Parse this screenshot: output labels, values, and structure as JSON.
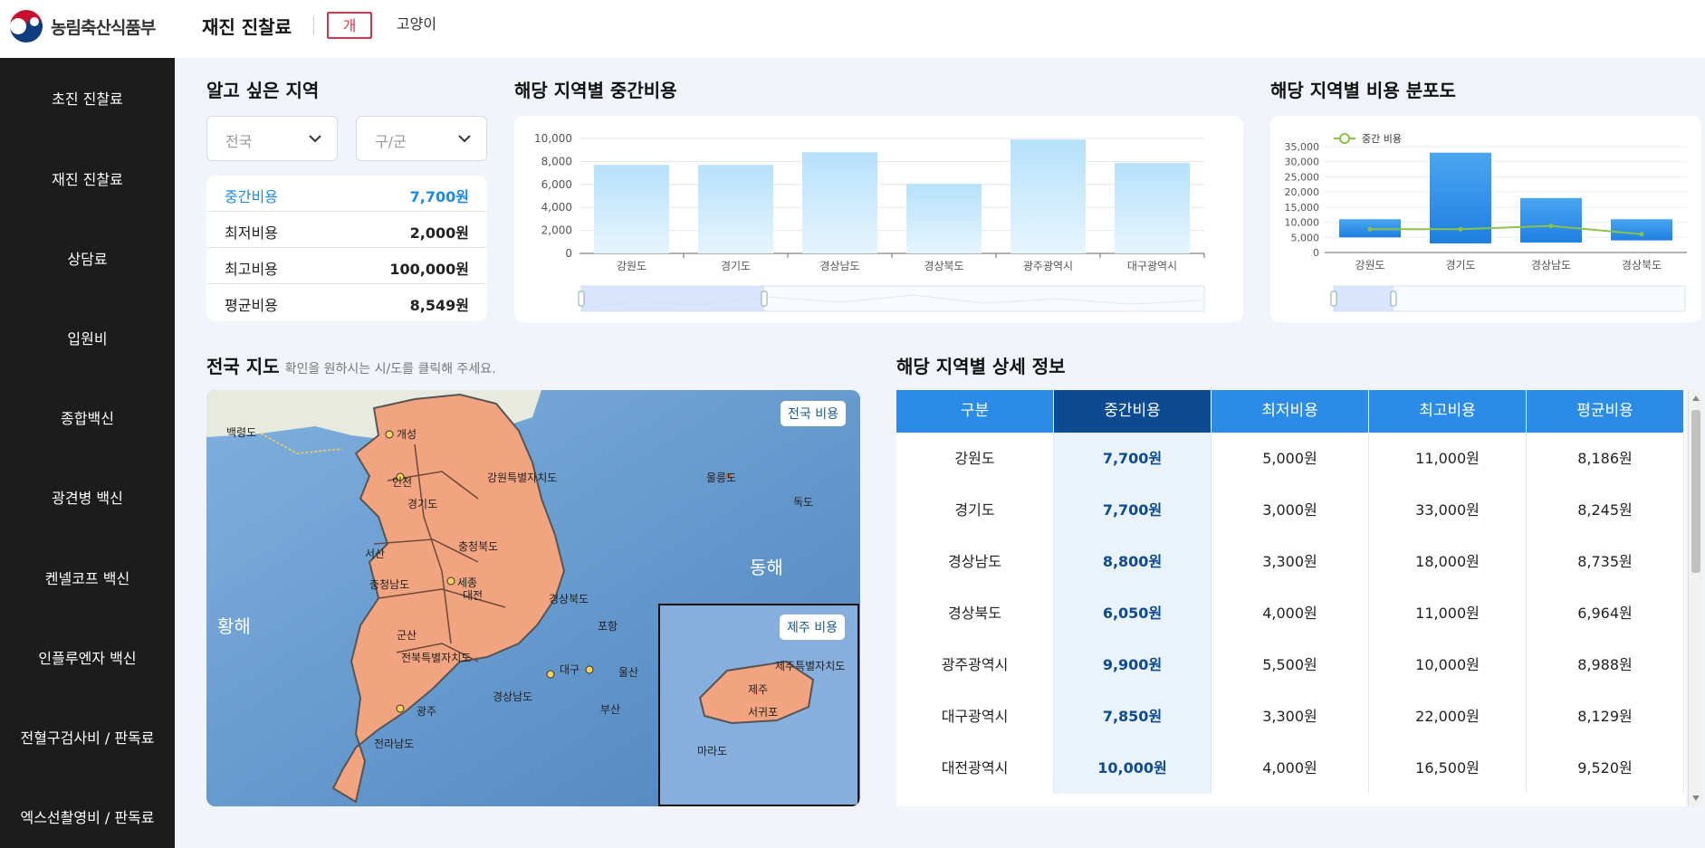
{
  "header": {
    "logo_text": "농림축산식품부",
    "title": "재진 진찰료",
    "tabs": [
      {
        "label": "개",
        "active": true
      },
      {
        "label": "고양이",
        "active": false
      }
    ]
  },
  "sidebar": {
    "items": [
      "초진 진찰료",
      "재진 진찰료",
      "상담료",
      "입원비",
      "종합백신",
      "광견병 백신",
      "켄넬코프 백신",
      "인플루엔자 백신",
      "전혈구검사비 / 판독료",
      "엑스선촬영비 / 판독료"
    ]
  },
  "region": {
    "title": "알고 싶은 지역",
    "select1": "전국",
    "select2": "구/군"
  },
  "stats": [
    {
      "label": "중간비용",
      "value": "7,700원",
      "highlight": true
    },
    {
      "label": "최저비용",
      "value": "2,000원"
    },
    {
      "label": "최고비용",
      "value": "100,000원"
    },
    {
      "label": "평균비용",
      "value": "8,549원"
    }
  ],
  "median_chart": {
    "title": "해당 지역별 중간비용"
  },
  "dist_chart": {
    "title": "해당 지역별 비용 분포도"
  },
  "chart_data": [
    {
      "type": "bar",
      "categories": [
        "강원도",
        "경기도",
        "경상남도",
        "경상북도",
        "광주광역시",
        "대구광역시"
      ],
      "values": [
        7700,
        7700,
        8800,
        6050,
        9900,
        7850
      ],
      "ylim": [
        0,
        10000
      ],
      "yticks": [
        "0",
        "2,000",
        "4,000",
        "6,000",
        "8,000",
        "10,000"
      ],
      "grid": true,
      "color": "#bfe6fb"
    },
    {
      "type": "bar",
      "categories": [
        "강원도",
        "경기도",
        "경상남도",
        "경상북도"
      ],
      "series": [
        {
          "kind": "range",
          "low": [
            5000,
            3000,
            3300,
            4000
          ],
          "high": [
            11000,
            33000,
            18000,
            11000
          ]
        },
        {
          "name": "중간 비용",
          "kind": "line",
          "values": [
            7700,
            7700,
            8800,
            6050
          ]
        }
      ],
      "ylim": [
        0,
        35000
      ],
      "yticks": [
        "0",
        "5,000",
        "10,000",
        "15,000",
        "20,000",
        "25,000",
        "30,000",
        "35,000"
      ],
      "legend": "top-left",
      "colors": {
        "bar": "#2a8ce6",
        "line": "#8bc34a"
      }
    }
  ],
  "map": {
    "title": "전국 지도",
    "subtitle": "확인을 원하시는 시/도를 클릭해 주세요.",
    "btn_nation": "전국 비용",
    "btn_jeju": "제주 비용",
    "labels": {
      "baekryeong": "백령도",
      "gaeseong": "개성",
      "ulleung": "울릉도",
      "dokdo": "독도",
      "gangwon": "강원특별자치도",
      "gyeonggi": "경기도",
      "chungbuk": "충청북도",
      "chungnam": "충청남도",
      "sejong": "세종",
      "daejeon": "대전",
      "gyeongbuk": "경상북도",
      "daegu": "대구",
      "ulsan": "울산",
      "busan": "부산",
      "jeonbuk": "전북특별자치도",
      "gyeongnam": "경상남도",
      "gwangju": "광주",
      "jeonnam": "전라남도",
      "jeju_region": "제주특별자치도",
      "jeju": "제주",
      "seogwipo": "서귀포",
      "marado": "마라도",
      "east_sea": "동해",
      "yellow_sea": "황해",
      "incheon": "인천",
      "seosan": "서산",
      "gunsan": "군산",
      "pohang": "포항"
    }
  },
  "detail": {
    "title": "해당 지역별 상세 정보",
    "columns": [
      "구분",
      "중간비용",
      "최저비용",
      "최고비용",
      "평균비용"
    ],
    "rows": [
      [
        "강원도",
        "7,700원",
        "5,000원",
        "11,000원",
        "8,186원"
      ],
      [
        "경기도",
        "7,700원",
        "3,000원",
        "33,000원",
        "8,245원"
      ],
      [
        "경상남도",
        "8,800원",
        "3,300원",
        "18,000원",
        "8,735원"
      ],
      [
        "경상북도",
        "6,050원",
        "4,000원",
        "11,000원",
        "6,964원"
      ],
      [
        "광주광역시",
        "9,900원",
        "5,500원",
        "10,000원",
        "8,988원"
      ],
      [
        "대구광역시",
        "7,850원",
        "3,300원",
        "22,000원",
        "8,129원"
      ],
      [
        "대전광역시",
        "10,000원",
        "4,000원",
        "16,500원",
        "9,520원"
      ]
    ]
  }
}
